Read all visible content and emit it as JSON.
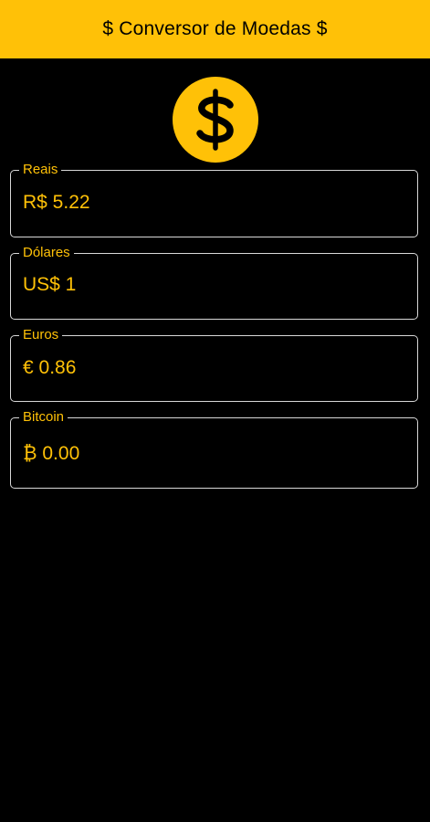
{
  "appbar": {
    "title": "$ Conversor de Moedas $"
  },
  "logo": {
    "icon": "dollar-coin-icon",
    "color": "#FFC107"
  },
  "fields": [
    {
      "label": "Reais",
      "value": "R$ 5.22"
    },
    {
      "label": "Dólares",
      "value": "US$ 1"
    },
    {
      "label": "Euros",
      "value": "€ 0.86"
    },
    {
      "label": "Bitcoin",
      "value": "₿ 0.00"
    }
  ],
  "colors": {
    "accent": "#FFC107",
    "background": "#000000",
    "border": "#D8D8D8"
  }
}
